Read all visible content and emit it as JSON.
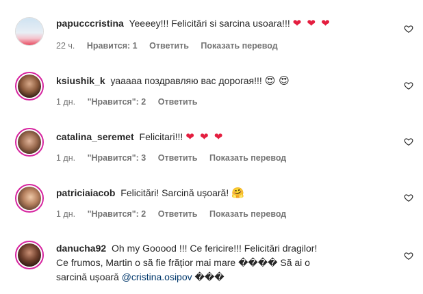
{
  "comments": [
    {
      "username": "papucccristina",
      "text": "Yeeeey!!! Felicitări si sarcina usoara!!!",
      "emoji": "❤ ❤ ❤",
      "time": "22 ч.",
      "likes": "Нравится: 1",
      "reply": "Ответить",
      "translate": "Показать перевод"
    },
    {
      "username": "ksiushik_k",
      "text": "уааааа поздравляю вас дорогая!!!",
      "emoji": "😍 😍",
      "time": "1 дн.",
      "likes": "\"Нравится\": 2",
      "reply": "Ответить"
    },
    {
      "username": "catalina_seremet",
      "text": "Felicitari!!!",
      "emoji": "❤ ❤ ❤",
      "time": "1 дн.",
      "likes": "\"Нравится\": 3",
      "reply": "Ответить",
      "translate": "Показать перевод"
    },
    {
      "username": "patriciaiacob",
      "text": "Felicitări! Sarcină ușoară!",
      "emoji": "🤗",
      "time": "1 дн.",
      "likes": "\"Нравится\": 2",
      "reply": "Ответить",
      "translate": "Показать перевод"
    },
    {
      "username": "danucha92",
      "text_line1": "Oh my Gooood !!! Ce fericire!!! Felicitări dragilor!",
      "text_line2": "Ce frumos, Martin o să fie frățior mai mare ���� Să ai o",
      "text_line3_pre": "sarcină ușoară",
      "mention": "@cristina.osipov",
      "text_line3_post": "���"
    }
  ],
  "colors": {
    "username": "#262626",
    "meta": "#737373",
    "heart": "#e41e3f",
    "mention": "#00376b",
    "story_ring": "#d6249f"
  }
}
